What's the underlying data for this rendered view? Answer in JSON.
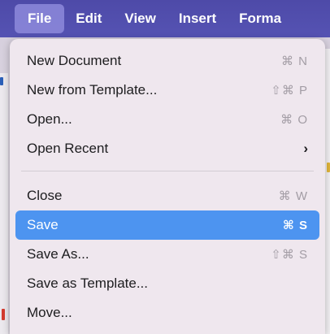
{
  "menubar": {
    "items": [
      {
        "label": "File",
        "active": true
      },
      {
        "label": "Edit"
      },
      {
        "label": "View"
      },
      {
        "label": "Insert"
      },
      {
        "label": "Forma"
      }
    ]
  },
  "file_menu": {
    "groups": [
      [
        {
          "label": "New Document",
          "shortcut": "⌘ N"
        },
        {
          "label": "New from Template...",
          "shortcut": "⇧⌘ P"
        },
        {
          "label": "Open...",
          "shortcut": "⌘ O"
        },
        {
          "label": "Open Recent",
          "shortcut": "›"
        }
      ],
      [
        {
          "label": "Close",
          "shortcut": "⌘ W"
        },
        {
          "label": "Save",
          "shortcut": "⌘ S",
          "highlighted": true
        },
        {
          "label": "Save As...",
          "shortcut": "⇧⌘ S"
        },
        {
          "label": "Save as Template...",
          "shortcut": ""
        },
        {
          "label": "Move...",
          "shortcut": ""
        }
      ]
    ]
  },
  "colors": {
    "menubar": "#4e4aa8",
    "highlight": "#4d94f0",
    "menu_background": "#efe7ee"
  }
}
